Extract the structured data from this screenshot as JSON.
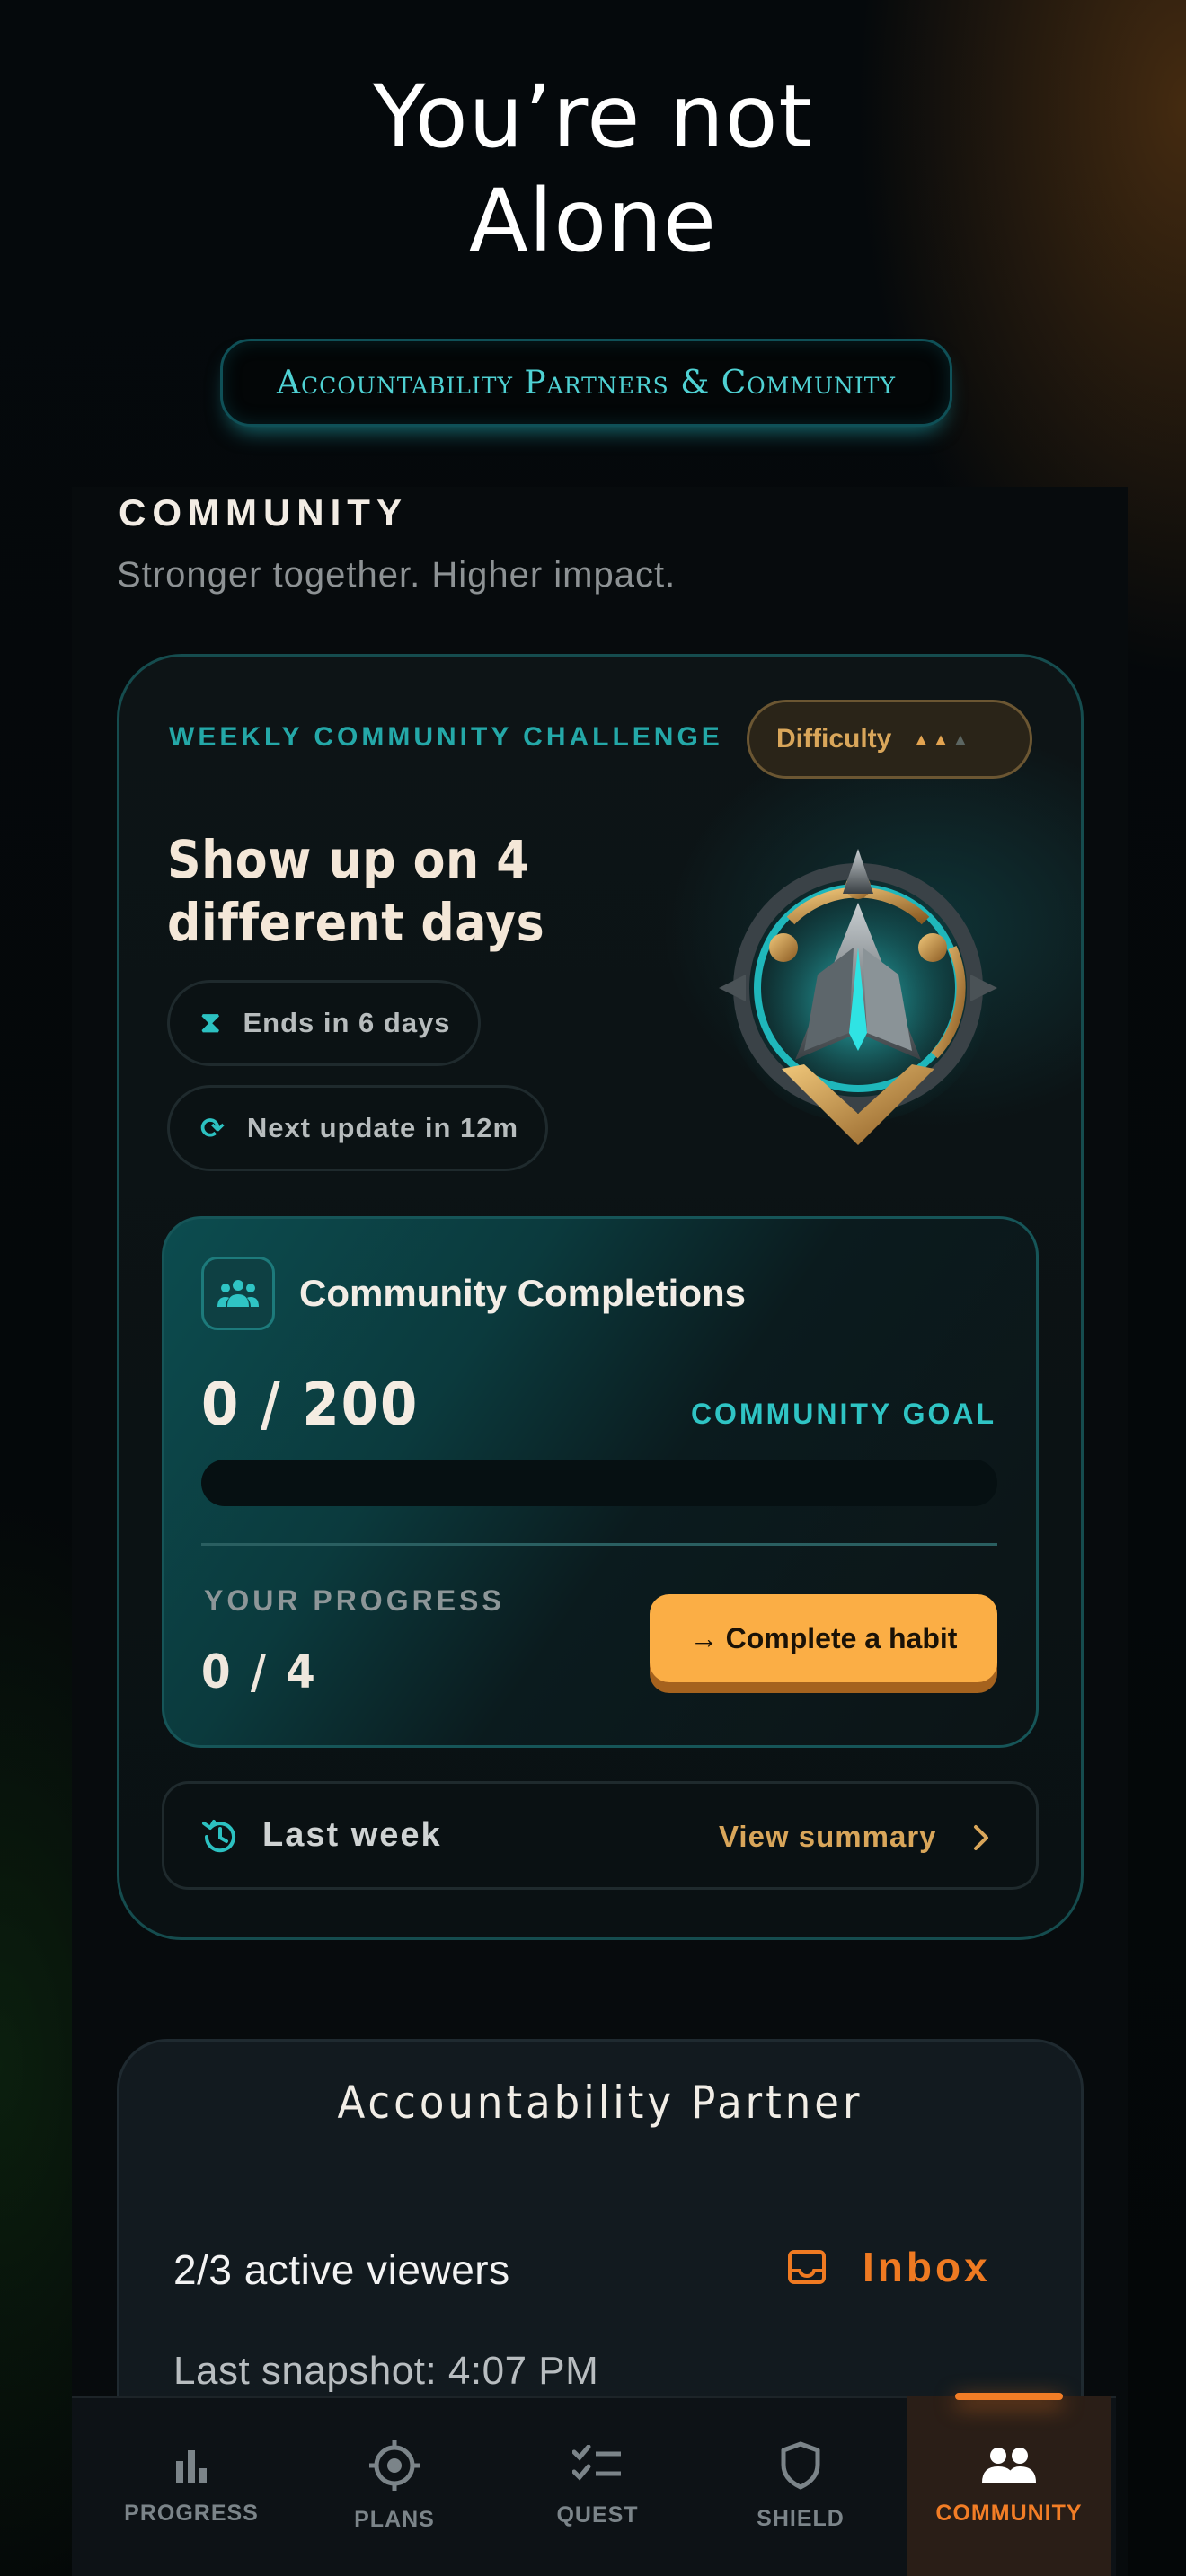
{
  "hero": {
    "title_line1": "You’re not",
    "title_line2": "Alone",
    "pill": "Accountability Partners & Community"
  },
  "section": {
    "title": "COMMUNITY",
    "subtitle": "Stronger together. Higher impact."
  },
  "challenge": {
    "label": "WEEKLY COMMUNITY CHALLENGE",
    "difficulty_label": "Difficulty",
    "difficulty_level": 2,
    "difficulty_max": 3,
    "heading": "Show up on 4 different days",
    "ends": "Ends in 6 days",
    "next_update": "Next update in 12m",
    "emblem_icon": "mountain-crest-badge-icon"
  },
  "completions": {
    "title": "Community Completions",
    "count": "0 / 200",
    "goal_label": "COMMUNITY GOAL",
    "progress_fraction": 0,
    "your_progress_label": "YOUR PROGRESS",
    "your_progress_value": "0 / 4",
    "cta_label": "Complete a habit"
  },
  "last_week": {
    "label": "Last week",
    "link": "View summary"
  },
  "partner": {
    "title": "Accountability Partner",
    "viewers": "2/3 active viewers",
    "inbox": "Inbox",
    "snapshot": "Last snapshot: 4:07 PM"
  },
  "nav": {
    "items": [
      {
        "label": "PROGRESS",
        "icon": "bar-chart-icon"
      },
      {
        "label": "PLANS",
        "icon": "target-icon"
      },
      {
        "label": "QUEST",
        "icon": "checklist-icon"
      },
      {
        "label": "SHIELD",
        "icon": "shield-icon"
      },
      {
        "label": "COMMUNITY",
        "icon": "people-icon"
      }
    ],
    "active": "COMMUNITY"
  },
  "colors": {
    "accent_teal": "#2cc1c1",
    "accent_orange": "#f27d26",
    "cta": "#fbae45",
    "gold": "#d9a65a"
  }
}
